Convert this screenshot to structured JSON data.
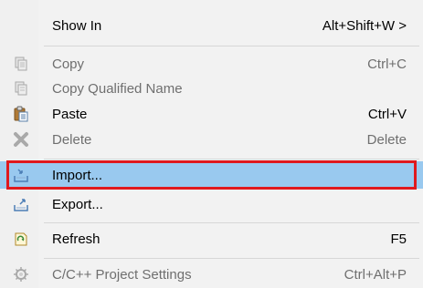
{
  "menu": {
    "items": [
      {
        "label": "Show In",
        "shortcut": "Alt+Shift+W >",
        "icon": "blank"
      },
      {
        "label": "Copy",
        "shortcut": "Ctrl+C",
        "icon": "copy-icon"
      },
      {
        "label": "Copy Qualified Name",
        "shortcut": "",
        "icon": "copy-qualified-name-icon"
      },
      {
        "label": "Paste",
        "shortcut": "Ctrl+V",
        "icon": "paste-icon"
      },
      {
        "label": "Delete",
        "shortcut": "Delete",
        "icon": "delete-icon"
      },
      {
        "label": "Import...",
        "shortcut": "",
        "icon": "import-icon"
      },
      {
        "label": "Export...",
        "shortcut": "",
        "icon": "export-icon"
      },
      {
        "label": "Refresh",
        "shortcut": "F5",
        "icon": "refresh-icon"
      },
      {
        "label": "C/C++ Project Settings",
        "shortcut": "Ctrl+Alt+P",
        "icon": "project-settings-icon"
      }
    ]
  },
  "colors": {
    "highlight_bg": "#99c9ef",
    "annotation_border": "#e0191d",
    "disabled_text": "#6f6f6f"
  }
}
